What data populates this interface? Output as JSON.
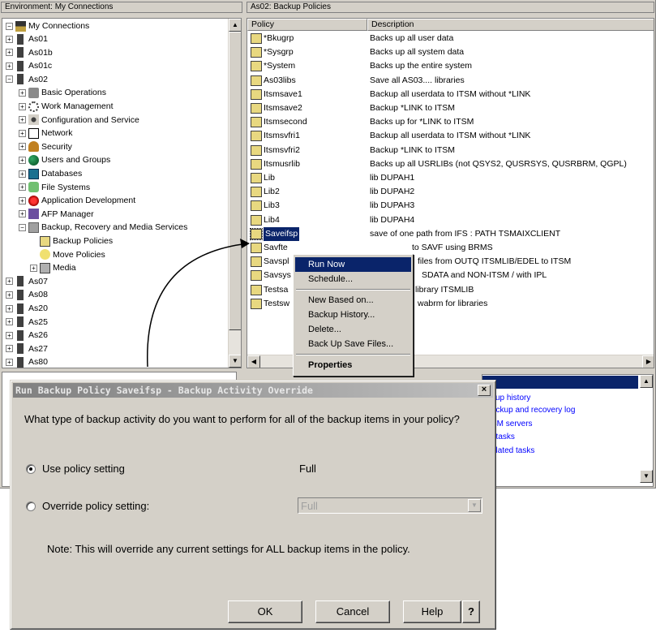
{
  "left_header": "Environment: My Connections",
  "right_header": "As02:  Backup Policies",
  "tree": {
    "root": "My Connections",
    "items": [
      {
        "label": "As01",
        "icon": "server-icon"
      },
      {
        "label": "As01b",
        "icon": "server-icon"
      },
      {
        "label": "As01c",
        "icon": "server-icon"
      },
      {
        "label": "As02",
        "icon": "server-icon"
      },
      {
        "label": "Basic Operations",
        "icon": "basic-operations-icon"
      },
      {
        "label": "Work Management",
        "icon": "work-management-icon"
      },
      {
        "label": "Configuration and Service",
        "icon": "configuration-icon"
      },
      {
        "label": "Network",
        "icon": "network-icon"
      },
      {
        "label": "Security",
        "icon": "security-icon"
      },
      {
        "label": "Users and Groups",
        "icon": "users-groups-icon"
      },
      {
        "label": "Databases",
        "icon": "databases-icon"
      },
      {
        "label": "File Systems",
        "icon": "file-systems-icon"
      },
      {
        "label": "Application Development",
        "icon": "app-development-icon"
      },
      {
        "label": "AFP Manager",
        "icon": "afp-manager-icon"
      },
      {
        "label": "Backup, Recovery and Media Services",
        "icon": "brms-icon"
      },
      {
        "label": "Backup Policies",
        "icon": "backup-policies-icon"
      },
      {
        "label": "Move Policies",
        "icon": "move-policies-icon"
      },
      {
        "label": "Media",
        "icon": "media-icon"
      },
      {
        "label": "As07",
        "icon": "server-icon"
      },
      {
        "label": "As08",
        "icon": "server-icon"
      },
      {
        "label": "As20",
        "icon": "server-icon"
      },
      {
        "label": "As25",
        "icon": "server-icon"
      },
      {
        "label": "As26",
        "icon": "server-icon"
      },
      {
        "label": "As27",
        "icon": "server-icon"
      },
      {
        "label": "As80",
        "icon": "server-icon"
      }
    ]
  },
  "list": {
    "columns": [
      "Policy",
      "Description"
    ],
    "rows": [
      {
        "policy": "*Bkugrp",
        "description": "Backs up all user data"
      },
      {
        "policy": "*Sysgrp",
        "description": "Backs up all system data"
      },
      {
        "policy": "*System",
        "description": "Backs up the entire system"
      },
      {
        "policy": "As03libs",
        "description": "Save all AS03.... libraries"
      },
      {
        "policy": "Itsmsave1",
        "description": "Backup all userdata to ITSM without *LINK"
      },
      {
        "policy": "Itsmsave2",
        "description": "Backup *LINK to ITSM"
      },
      {
        "policy": "Itsmsecond",
        "description": "Backs up for *LINK to ITSM"
      },
      {
        "policy": "Itsmsvfri1",
        "description": "Backup all userdata to ITSM without *LINK"
      },
      {
        "policy": "Itsmsvfri2",
        "description": "Backup *LINK to ITSM"
      },
      {
        "policy": "Itsmusrlib",
        "description": "Backs up all USRLIBs (not QSYS2, QUSRSYS, QUSRBRM, QGPL)"
      },
      {
        "policy": "Lib",
        "description": "lib DUPAH1"
      },
      {
        "policy": "Lib2",
        "description": "lib DUPAH2"
      },
      {
        "policy": "Lib3",
        "description": "lib DUPAH3"
      },
      {
        "policy": "Lib4",
        "description": "lib DUPAH4"
      },
      {
        "policy": "Saveifsp",
        "description": "save of one path from IFS : PATH TSMAIXCLIENT"
      },
      {
        "policy": "Savfte",
        "description": "to SAVF using BRMS"
      },
      {
        "policy": "Savspl",
        "description": "files from OUTQ ITSMLIB/EDEL  to ITSM"
      },
      {
        "policy": "Savsys",
        "description": "SDATA and NON-ITSM / with IPL"
      },
      {
        "policy": "Testsa",
        "description": "library ITSMLIB"
      },
      {
        "policy": "Testsw",
        "description": "wabrm for libraries"
      }
    ]
  },
  "context_menu": {
    "items": [
      "Run Now",
      "Schedule...",
      "New Based on...",
      "Backup History...",
      "Delete...",
      "Back Up Save Files...",
      "Properties"
    ]
  },
  "tasks_links": [
    "kup history",
    "ackup and recovery log",
    "SM servers",
    "t tasks",
    "elated tasks"
  ],
  "dialog": {
    "title": "Run Backup Policy Saveifsp - Backup Activity Override",
    "close": "×",
    "question": "What type of backup activity do you want to perform for all of the backup items in your policy?",
    "option1_label": "Use policy setting",
    "option1_value": "Full",
    "option2_label": "Override policy setting:",
    "option2_value": "Full",
    "note": "Note:  This will override any current settings for ALL backup items in the policy.",
    "ok": "OK",
    "cancel": "Cancel",
    "help": "Help",
    "whats_this": "?"
  }
}
